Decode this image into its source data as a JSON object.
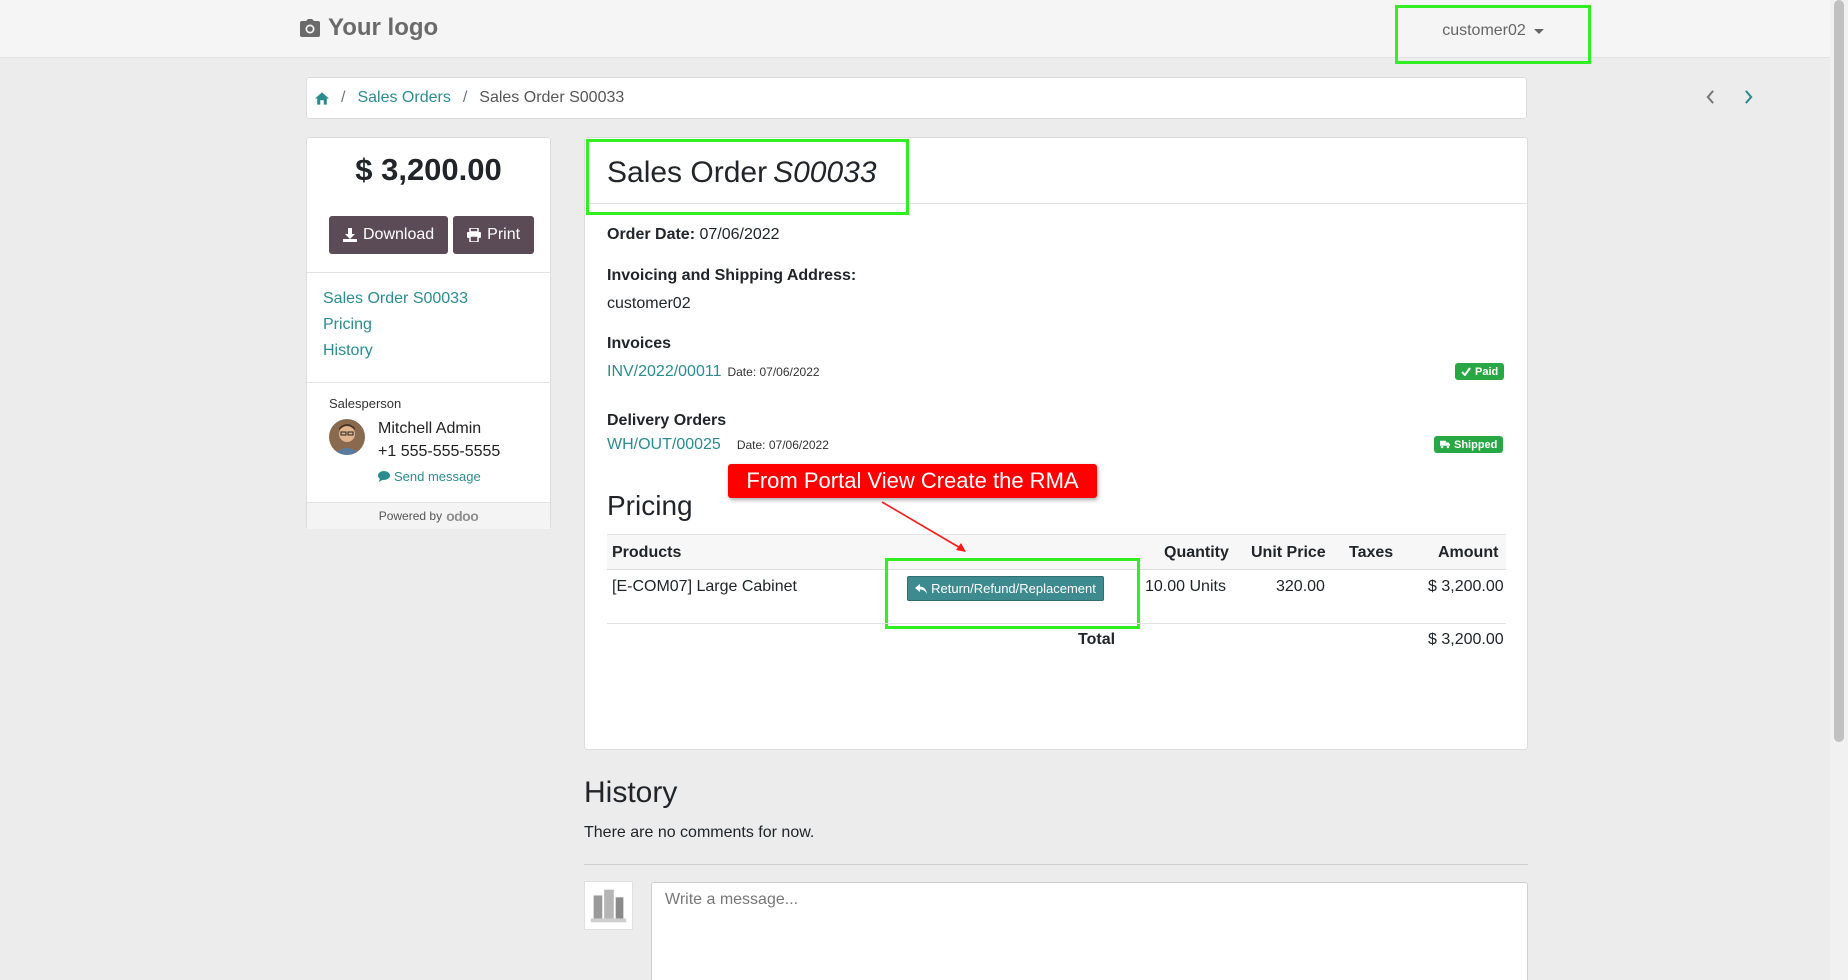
{
  "header": {
    "logo_text": "Your logo",
    "user_label": "customer02"
  },
  "breadcrumb": {
    "item1": "Sales Orders",
    "current": "Sales Order S00033",
    "separator": "/"
  },
  "sidebar": {
    "total": "$ 3,200.00",
    "download_label": "Download",
    "print_label": "Print",
    "nav": [
      "Sales Order S00033",
      "Pricing",
      "History"
    ],
    "salesperson_label": "Salesperson",
    "salesperson_name": "Mitchell Admin",
    "salesperson_phone": "+1 555-555-5555",
    "send_message": "Send message",
    "powered_by": "Powered by",
    "powered_brand": "odoo"
  },
  "order": {
    "title": "Sales Order",
    "number": "S00033",
    "order_date_label": "Order Date:",
    "order_date": "07/06/2022",
    "address_label": "Invoicing and Shipping Address:",
    "address": "customer02",
    "invoices_label": "Invoices",
    "invoice_ref": "INV/2022/00011",
    "invoice_date_label": "Date:",
    "invoice_date": "07/06/2022",
    "paid_label": "Paid",
    "delivery_label": "Delivery Orders",
    "delivery_ref": "WH/OUT/00025",
    "delivery_date_label": "Date:",
    "delivery_date": "07/06/2022",
    "shipped_label": "Shipped"
  },
  "pricing": {
    "title": "Pricing",
    "columns": {
      "products": "Products",
      "quantity": "Quantity",
      "unit_price": "Unit Price",
      "taxes": "Taxes",
      "amount": "Amount"
    },
    "rows": [
      {
        "product": "[E-COM07] Large Cabinet",
        "action": "Return/Refund/Replacement",
        "quantity": "10.00 Units",
        "unit_price": "320.00",
        "taxes": "",
        "amount": "$ 3,200.00"
      }
    ],
    "total_label": "Total",
    "total_value": "$ 3,200.00"
  },
  "annotation": {
    "callout_text": "From Portal View Create the RMA",
    "callout_color": "#ff0000",
    "highlight_color": "#33ee22"
  },
  "history": {
    "title": "History",
    "empty_text": "There are no comments for now.",
    "placeholder": "Write a message..."
  },
  "colors": {
    "link": "#2b8c8f",
    "dark_button": "#5b4b57",
    "success": "#28a745",
    "action_button": "#3d8b8f"
  }
}
